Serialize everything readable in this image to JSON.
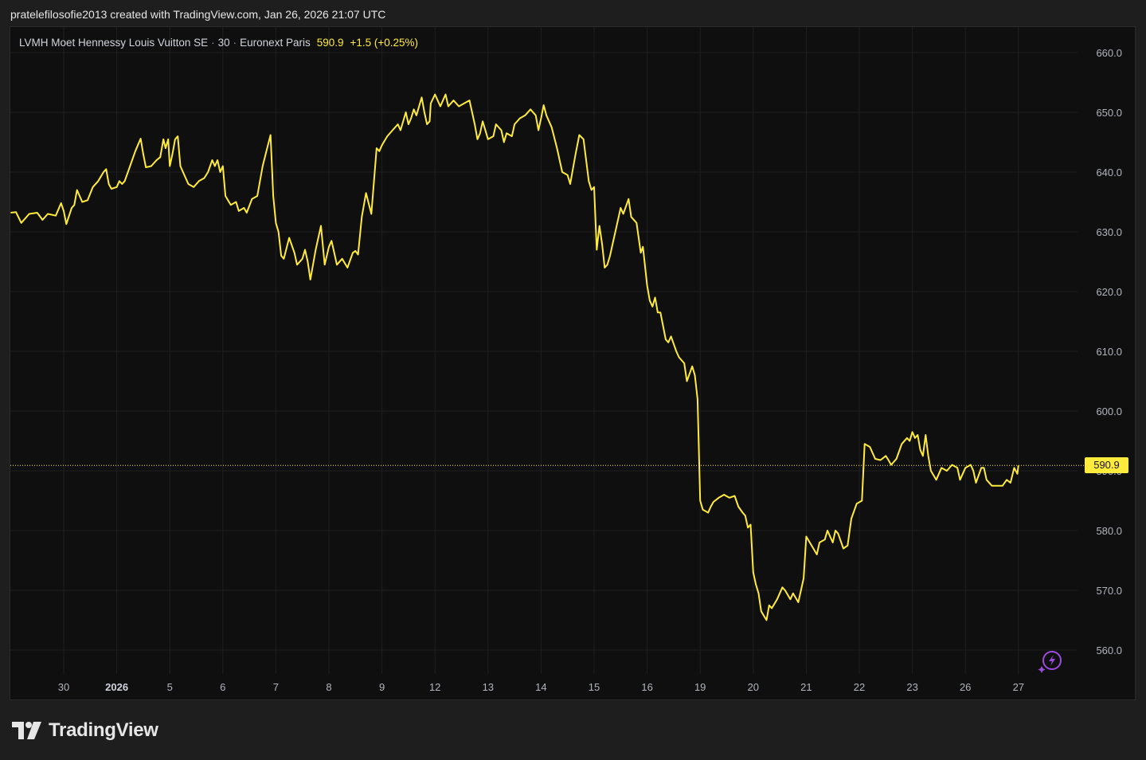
{
  "header": {
    "text": "pratelefilosofie2013 created with TradingView.com, Jan 26, 2026 21:07 UTC"
  },
  "legend": {
    "symbol": "LVMH Moet Hennessy Louis Vuitton SE",
    "interval": "30",
    "exchange": "Euronext Paris",
    "separator": "·",
    "price": "590.9",
    "change": "+1.5 (+0.25%)"
  },
  "brand": {
    "name": "TradingView"
  },
  "colors": {
    "line": "#ffeb3b",
    "background": "#0f0f0f",
    "grid": "#1f1f1f",
    "frame": "#1e1e1e"
  },
  "chart_data": {
    "type": "line",
    "title": "",
    "xlabel": "",
    "ylabel": "",
    "ylim": [
      555.0,
      665.0
    ],
    "yticks": [
      "660.0",
      "650.0",
      "640.0",
      "630.0",
      "620.0",
      "610.0",
      "600.0",
      "590.0",
      "580.0",
      "570.0",
      "560.0"
    ],
    "last_price": 590.9,
    "last_price_label": "590.9",
    "grid": true,
    "legend_position": "top-left",
    "x_labels": [
      {
        "label": "30",
        "index": 0,
        "bold": false
      },
      {
        "label": "2026",
        "index": 1,
        "bold": true
      },
      {
        "label": "5",
        "index": 2,
        "bold": false
      },
      {
        "label": "6",
        "index": 3,
        "bold": false
      },
      {
        "label": "7",
        "index": 4,
        "bold": false
      },
      {
        "label": "8",
        "index": 5,
        "bold": false
      },
      {
        "label": "9",
        "index": 6,
        "bold": false
      },
      {
        "label": "12",
        "index": 7,
        "bold": false
      },
      {
        "label": "13",
        "index": 8,
        "bold": false
      },
      {
        "label": "14",
        "index": 9,
        "bold": false
      },
      {
        "label": "15",
        "index": 10,
        "bold": false
      },
      {
        "label": "16",
        "index": 11,
        "bold": false
      },
      {
        "label": "19",
        "index": 12,
        "bold": false
      },
      {
        "label": "20",
        "index": 13,
        "bold": false
      },
      {
        "label": "21",
        "index": 14,
        "bold": false
      },
      {
        "label": "22",
        "index": 15,
        "bold": false
      },
      {
        "label": "23",
        "index": 16,
        "bold": false
      },
      {
        "label": "26",
        "index": 17,
        "bold": false
      },
      {
        "label": "27",
        "index": 18,
        "bold": false
      }
    ],
    "series": [
      {
        "values": [
          [
            -1.0,
            633.2
          ],
          [
            -0.9,
            633.3
          ],
          [
            -0.8,
            631.5
          ],
          [
            -0.65,
            633.0
          ],
          [
            -0.5,
            633.2
          ],
          [
            -0.4,
            632.0
          ],
          [
            -0.3,
            633.0
          ],
          [
            -0.15,
            632.7
          ],
          [
            -0.05,
            634.8
          ],
          [
            0.0,
            633.5
          ],
          [
            0.05,
            631.3
          ],
          [
            0.15,
            634.0
          ],
          [
            0.2,
            634.5
          ],
          [
            0.25,
            637.0
          ],
          [
            0.35,
            635.0
          ],
          [
            0.45,
            635.3
          ],
          [
            0.55,
            637.5
          ],
          [
            0.65,
            638.5
          ],
          [
            0.75,
            640.0
          ],
          [
            0.8,
            640.5
          ],
          [
            0.85,
            638.0
          ],
          [
            0.9,
            637.2
          ],
          [
            1.0,
            637.5
          ],
          [
            1.05,
            638.5
          ],
          [
            1.1,
            638.0
          ],
          [
            1.15,
            638.5
          ],
          [
            1.25,
            641.0
          ],
          [
            1.35,
            643.5
          ],
          [
            1.45,
            645.6
          ],
          [
            1.5,
            643.0
          ],
          [
            1.55,
            640.8
          ],
          [
            1.65,
            641.0
          ],
          [
            1.75,
            642.0
          ],
          [
            1.82,
            642.5
          ],
          [
            1.88,
            645.5
          ],
          [
            1.92,
            644.0
          ],
          [
            1.97,
            645.5
          ],
          [
            2.0,
            641.0
          ],
          [
            2.05,
            643.0
          ],
          [
            2.1,
            645.5
          ],
          [
            2.15,
            646.0
          ],
          [
            2.2,
            641.0
          ],
          [
            2.25,
            640.0
          ],
          [
            2.35,
            638.0
          ],
          [
            2.45,
            637.5
          ],
          [
            2.55,
            638.5
          ],
          [
            2.65,
            639.0
          ],
          [
            2.72,
            640.0
          ],
          [
            2.8,
            642.0
          ],
          [
            2.85,
            641.0
          ],
          [
            2.9,
            642.0
          ],
          [
            2.95,
            640.0
          ],
          [
            3.0,
            641.0
          ],
          [
            3.05,
            636.0
          ],
          [
            3.15,
            634.5
          ],
          [
            3.25,
            635.0
          ],
          [
            3.3,
            633.5
          ],
          [
            3.4,
            634.0
          ],
          [
            3.45,
            633.2
          ],
          [
            3.55,
            635.5
          ],
          [
            3.65,
            636.0
          ],
          [
            3.75,
            641.0
          ],
          [
            3.85,
            644.5
          ],
          [
            3.9,
            646.2
          ],
          [
            3.95,
            636.0
          ],
          [
            4.0,
            631.5
          ],
          [
            4.05,
            630.0
          ],
          [
            4.1,
            626.0
          ],
          [
            4.15,
            625.5
          ],
          [
            4.25,
            629.0
          ],
          [
            4.35,
            626.5
          ],
          [
            4.4,
            624.5
          ],
          [
            4.5,
            625.5
          ],
          [
            4.55,
            627.0
          ],
          [
            4.6,
            625.0
          ],
          [
            4.65,
            622.0
          ],
          [
            4.75,
            627.0
          ],
          [
            4.85,
            631.0
          ],
          [
            4.92,
            624.5
          ],
          [
            5.0,
            627.5
          ],
          [
            5.05,
            628.5
          ],
          [
            5.1,
            626.5
          ],
          [
            5.15,
            624.5
          ],
          [
            5.25,
            625.5
          ],
          [
            5.35,
            624.0
          ],
          [
            5.45,
            626.5
          ],
          [
            5.5,
            626.8
          ],
          [
            5.55,
            626.2
          ],
          [
            5.62,
            632.5
          ],
          [
            5.7,
            636.5
          ],
          [
            5.8,
            633.0
          ],
          [
            5.9,
            644.0
          ],
          [
            5.95,
            643.5
          ],
          [
            6.0,
            644.5
          ],
          [
            6.1,
            646.0
          ],
          [
            6.2,
            647.0
          ],
          [
            6.3,
            648.0
          ],
          [
            6.35,
            647.0
          ],
          [
            6.45,
            650.0
          ],
          [
            6.5,
            648.0
          ],
          [
            6.55,
            649.0
          ],
          [
            6.6,
            650.5
          ],
          [
            6.65,
            649.5
          ],
          [
            6.75,
            652.5
          ],
          [
            6.8,
            650.0
          ],
          [
            6.85,
            648.0
          ],
          [
            6.9,
            648.5
          ],
          [
            6.92,
            651.5
          ],
          [
            7.0,
            653.0
          ],
          [
            7.1,
            651.0
          ],
          [
            7.2,
            653.0
          ],
          [
            7.25,
            651.0
          ],
          [
            7.35,
            652.0
          ],
          [
            7.45,
            651.0
          ],
          [
            7.55,
            651.5
          ],
          [
            7.65,
            652.0
          ],
          [
            7.75,
            648.0
          ],
          [
            7.8,
            645.5
          ],
          [
            7.85,
            646.5
          ],
          [
            7.9,
            648.5
          ],
          [
            8.0,
            645.5
          ],
          [
            8.1,
            646.0
          ],
          [
            8.15,
            648.0
          ],
          [
            8.25,
            647.0
          ],
          [
            8.3,
            645.0
          ],
          [
            8.35,
            646.5
          ],
          [
            8.45,
            646.0
          ],
          [
            8.5,
            648.0
          ],
          [
            8.6,
            649.0
          ],
          [
            8.7,
            649.5
          ],
          [
            8.8,
            650.5
          ],
          [
            8.9,
            649.5
          ],
          [
            8.95,
            647.0
          ],
          [
            9.0,
            649.0
          ],
          [
            9.05,
            651.2
          ],
          [
            9.1,
            649.5
          ],
          [
            9.2,
            647.5
          ],
          [
            9.3,
            644.0
          ],
          [
            9.4,
            640.0
          ],
          [
            9.5,
            639.5
          ],
          [
            9.55,
            638.0
          ],
          [
            9.65,
            643.0
          ],
          [
            9.72,
            646.2
          ],
          [
            9.8,
            645.5
          ],
          [
            9.85,
            642.0
          ],
          [
            9.9,
            638.5
          ],
          [
            9.95,
            637.0
          ],
          [
            10.0,
            637.5
          ],
          [
            10.05,
            627.0
          ],
          [
            10.1,
            631.0
          ],
          [
            10.15,
            628.0
          ],
          [
            10.2,
            624.0
          ],
          [
            10.25,
            624.5
          ],
          [
            10.3,
            626.0
          ],
          [
            10.35,
            628.0
          ],
          [
            10.45,
            632.0
          ],
          [
            10.5,
            634.0
          ],
          [
            10.55,
            633.0
          ],
          [
            10.65,
            635.5
          ],
          [
            10.7,
            632.5
          ],
          [
            10.8,
            631.5
          ],
          [
            10.88,
            626.5
          ],
          [
            10.92,
            627.5
          ],
          [
            11.0,
            621.0
          ],
          [
            11.05,
            618.5
          ],
          [
            11.1,
            617.5
          ],
          [
            11.15,
            619.0
          ],
          [
            11.2,
            616.5
          ],
          [
            11.25,
            616.5
          ],
          [
            11.35,
            612.0
          ],
          [
            11.4,
            611.5
          ],
          [
            11.45,
            612.5
          ],
          [
            11.55,
            610.0
          ],
          [
            11.6,
            609.0
          ],
          [
            11.7,
            608.0
          ],
          [
            11.75,
            605.0
          ],
          [
            11.85,
            607.5
          ],
          [
            11.9,
            606.0
          ],
          [
            11.95,
            602.0
          ],
          [
            12.0,
            585.0
          ],
          [
            12.05,
            583.5
          ],
          [
            12.15,
            583.0
          ],
          [
            12.2,
            584.0
          ],
          [
            12.25,
            584.8
          ],
          [
            12.35,
            585.5
          ],
          [
            12.45,
            586.0
          ],
          [
            12.55,
            585.5
          ],
          [
            12.65,
            585.8
          ],
          [
            12.72,
            584.0
          ],
          [
            12.8,
            583.0
          ],
          [
            12.85,
            582.5
          ],
          [
            12.9,
            580.5
          ],
          [
            12.95,
            581.0
          ],
          [
            13.0,
            573.0
          ],
          [
            13.05,
            571.0
          ],
          [
            13.1,
            569.5
          ],
          [
            13.15,
            566.5
          ],
          [
            13.25,
            565.0
          ],
          [
            13.3,
            567.5
          ],
          [
            13.35,
            567.0
          ],
          [
            13.45,
            568.5
          ],
          [
            13.55,
            570.5
          ],
          [
            13.6,
            570.0
          ],
          [
            13.7,
            568.5
          ],
          [
            13.75,
            569.5
          ],
          [
            13.85,
            568.0
          ],
          [
            13.95,
            572.0
          ],
          [
            14.0,
            579.0
          ],
          [
            14.1,
            577.5
          ],
          [
            14.2,
            576.0
          ],
          [
            14.25,
            578.0
          ],
          [
            14.35,
            578.5
          ],
          [
            14.4,
            580.0
          ],
          [
            14.5,
            578.0
          ],
          [
            14.55,
            580.0
          ],
          [
            14.6,
            579.5
          ],
          [
            14.7,
            577.0
          ],
          [
            14.78,
            577.5
          ],
          [
            14.85,
            582.0
          ],
          [
            14.95,
            584.5
          ],
          [
            15.05,
            585.0
          ],
          [
            15.1,
            594.5
          ],
          [
            15.2,
            594.0
          ],
          [
            15.3,
            592.0
          ],
          [
            15.4,
            591.8
          ],
          [
            15.5,
            592.5
          ],
          [
            15.55,
            591.8
          ],
          [
            15.6,
            591.0
          ],
          [
            15.7,
            592.0
          ],
          [
            15.8,
            594.5
          ],
          [
            15.9,
            595.5
          ],
          [
            15.95,
            595.0
          ],
          [
            16.0,
            596.5
          ],
          [
            16.05,
            595.5
          ],
          [
            16.1,
            596.0
          ],
          [
            16.15,
            593.5
          ],
          [
            16.2,
            592.5
          ],
          [
            16.25,
            596.0
          ],
          [
            16.3,
            592.5
          ],
          [
            16.35,
            590.0
          ],
          [
            16.45,
            588.5
          ],
          [
            16.55,
            590.5
          ],
          [
            16.65,
            590.0
          ],
          [
            16.75,
            591.0
          ],
          [
            16.85,
            590.5
          ],
          [
            16.9,
            588.5
          ],
          [
            17.0,
            590.5
          ],
          [
            17.1,
            591.0
          ],
          [
            17.15,
            590.0
          ],
          [
            17.2,
            588.0
          ],
          [
            17.3,
            590.5
          ],
          [
            17.35,
            590.5
          ],
          [
            17.4,
            588.5
          ],
          [
            17.5,
            587.5
          ],
          [
            17.6,
            587.5
          ],
          [
            17.7,
            587.5
          ],
          [
            17.78,
            588.5
          ],
          [
            17.85,
            588.0
          ],
          [
            17.92,
            590.5
          ],
          [
            17.98,
            589.5
          ],
          [
            18.0,
            590.9
          ]
        ]
      }
    ]
  }
}
